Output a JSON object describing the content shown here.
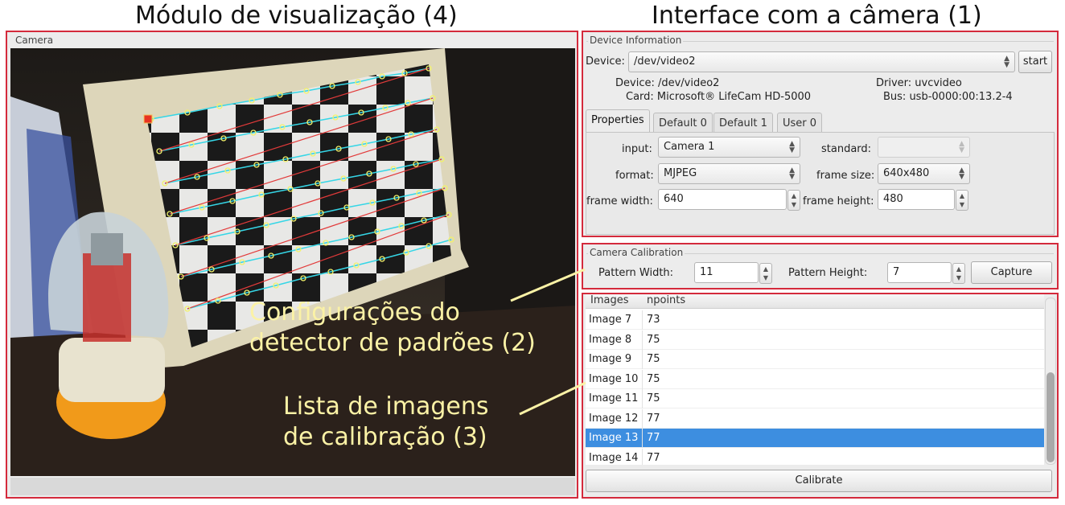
{
  "captions": {
    "left": "Módulo de visualização (4)",
    "right": "Interface com a câmera (1)"
  },
  "camera": {
    "group_title": "Camera"
  },
  "device_info": {
    "group_title": "Device Information",
    "device_label": "Device:",
    "device_value": "/dev/video2",
    "start_label": "start",
    "info": {
      "device_line": "Device: /dev/video2",
      "card_line": "Card: Microsoft® LifeCam HD-5000",
      "driver_line": "Driver: uvcvideo",
      "bus_line": "Bus: usb-0000:00:13.2-4"
    },
    "tabs": [
      "Properties",
      "Default 0",
      "Default 1",
      "User 0"
    ],
    "properties": {
      "input_label": "input:",
      "input_value": "Camera 1",
      "standard_label": "standard:",
      "standard_value": "",
      "format_label": "format:",
      "format_value": "MJPEG",
      "frame_size_label": "frame size:",
      "frame_size_value": "640x480",
      "frame_width_label": "frame width:",
      "frame_width_value": "640",
      "frame_height_label": "frame height:",
      "frame_height_value": "480"
    }
  },
  "calibration": {
    "group_title": "Camera Calibration",
    "pattern_width_label": "Pattern Width:",
    "pattern_width_value": "11",
    "pattern_height_label": "Pattern Height:",
    "pattern_height_value": "7",
    "capture_label": "Capture"
  },
  "images_table": {
    "columns": [
      "Images",
      "npoints"
    ],
    "rows": [
      {
        "image": "Image 7",
        "npoints": "73",
        "selected": false
      },
      {
        "image": "Image 8",
        "npoints": "75",
        "selected": false
      },
      {
        "image": "Image 9",
        "npoints": "75",
        "selected": false
      },
      {
        "image": "Image 10",
        "npoints": "75",
        "selected": false
      },
      {
        "image": "Image 11",
        "npoints": "75",
        "selected": false
      },
      {
        "image": "Image 12",
        "npoints": "77",
        "selected": false
      },
      {
        "image": "Image 13",
        "npoints": "77",
        "selected": true
      },
      {
        "image": "Image 14",
        "npoints": "77",
        "selected": false
      }
    ],
    "calibrate_label": "Calibrate"
  },
  "annotations": {
    "pattern_line1": "Configurações do",
    "pattern_line2": "detector de padrões (2)",
    "list_line1": "Lista de imagens",
    "list_line2": "de calibração (3)"
  },
  "colors": {
    "highlight_box": "#d42a3c",
    "selection": "#3d8ee0",
    "annotation_text": "#fbf2a6",
    "detected_corner": "#f2f26a",
    "grid_line_cyan": "#35d6e6",
    "grid_line_red": "#e23a3a"
  }
}
